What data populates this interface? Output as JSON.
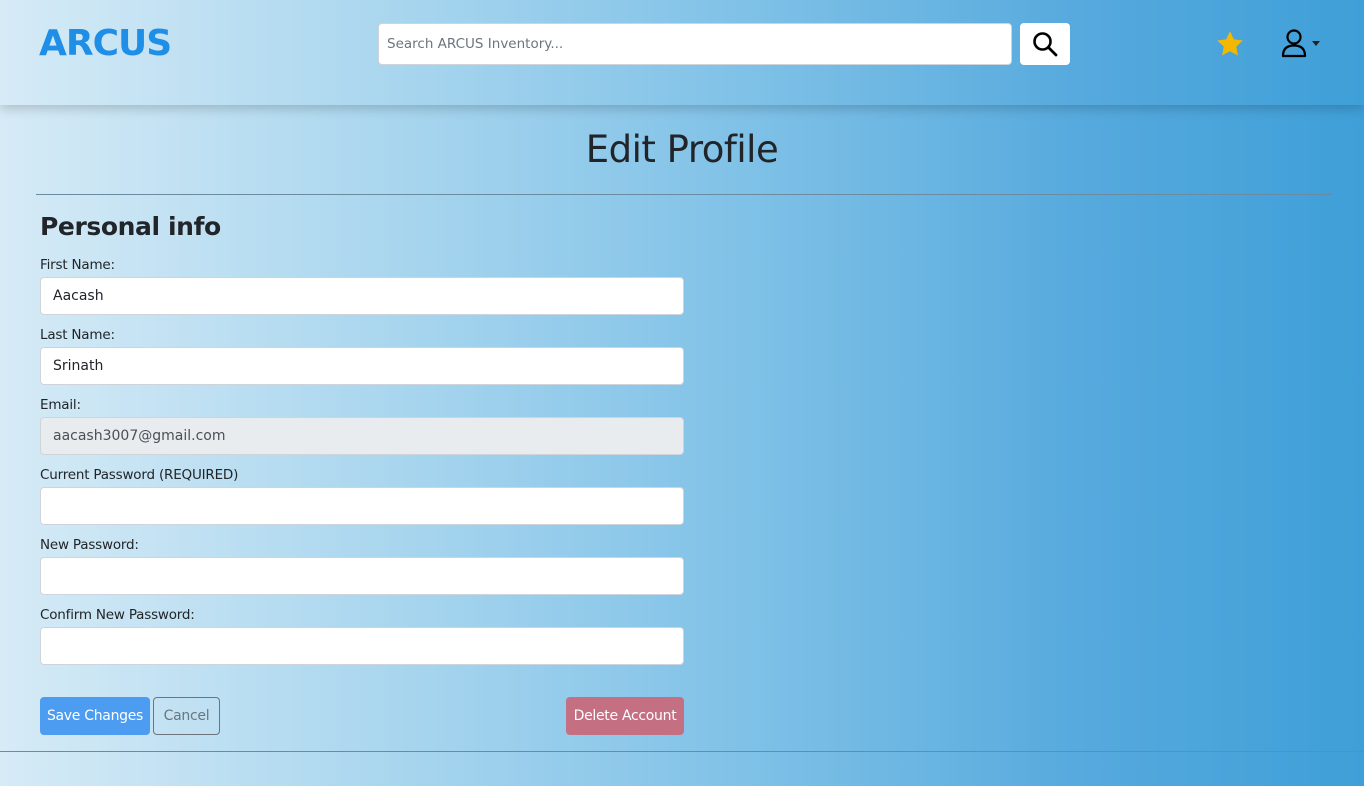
{
  "header": {
    "logo_text": "ARCUS",
    "search": {
      "placeholder": "Search ARCUS Inventory...",
      "value": ""
    },
    "icons": {
      "search": "search-icon",
      "favorites": "star-icon",
      "account": "user-icon"
    }
  },
  "page": {
    "title": "Edit Profile",
    "section_heading": "Personal info"
  },
  "form": {
    "first_name": {
      "label": "First Name:",
      "value": "Aacash"
    },
    "last_name": {
      "label": "Last Name:",
      "value": "Srinath"
    },
    "email": {
      "label": "Email:",
      "value": "aacash3007@gmail.com"
    },
    "current_password": {
      "label": "Current Password (REQUIRED)",
      "value": ""
    },
    "new_password": {
      "label": "New Password:",
      "value": ""
    },
    "confirm_password": {
      "label": "Confirm New Password:",
      "value": ""
    }
  },
  "actions": {
    "save_label": "Save Changes",
    "cancel_label": "Cancel",
    "delete_label": "Delete Account"
  },
  "colors": {
    "brand": "#1f8ee6",
    "primary": "#4c9cf1",
    "danger": "#c46f82",
    "star": "#f5b800"
  }
}
